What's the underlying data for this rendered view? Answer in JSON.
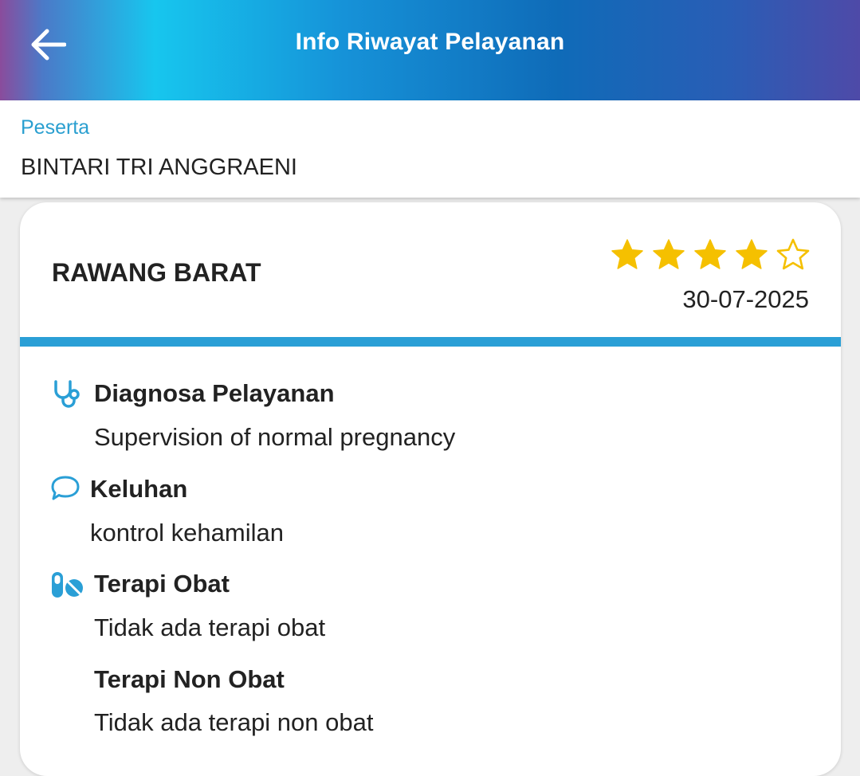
{
  "header": {
    "title": "Info Riwayat Pelayanan",
    "back_icon": "arrow-left-icon"
  },
  "participant": {
    "label": "Peserta",
    "name": "BINTARI TRI ANGGRAENI"
  },
  "visit": {
    "facility": "RAWANG BARAT",
    "rating": 4,
    "rating_max": 5,
    "date": "30-07-2025",
    "accent_color": "#2a9fd6",
    "star_color": "#f5c000"
  },
  "sections": {
    "diagnosa": {
      "icon": "stethoscope-icon",
      "title": "Diagnosa Pelayanan",
      "value": "Supervision of normal pregnancy"
    },
    "keluhan": {
      "icon": "chat-bubble-icon",
      "title": "Keluhan",
      "value": "kontrol kehamilan"
    },
    "terapi_obat": {
      "icon": "pills-icon",
      "title": "Terapi Obat",
      "value": "Tidak ada terapi obat"
    },
    "terapi_non_obat": {
      "title": "Terapi Non Obat",
      "value": "Tidak ada terapi non obat"
    }
  }
}
